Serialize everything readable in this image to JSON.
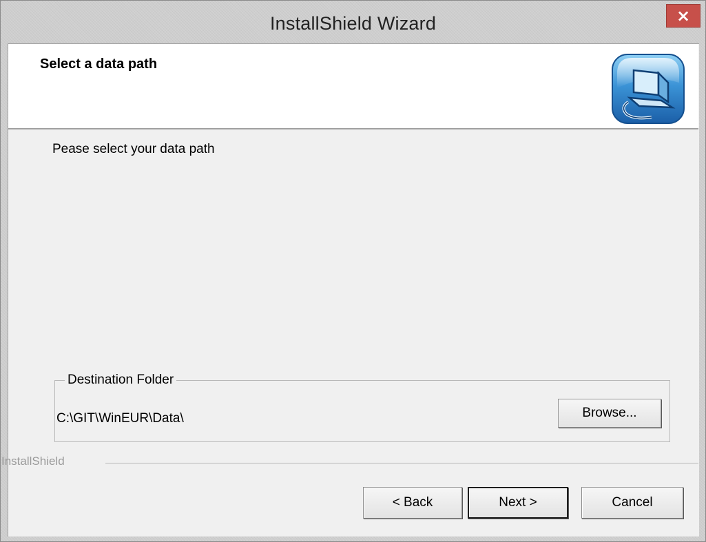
{
  "window": {
    "title": "InstallShield Wizard",
    "close_label": "×"
  },
  "header": {
    "title": "Select a data path",
    "icon": "installer-computer-icon"
  },
  "body": {
    "prompt": "Pease select your data path"
  },
  "destination": {
    "legend": "Destination Folder",
    "path": "C:\\GIT\\WinEUR\\Data\\",
    "browse_label": "Browse..."
  },
  "footer": {
    "brand": "InstallShield",
    "back_label": "< Back",
    "next_label": "Next >",
    "cancel_label": "Cancel"
  },
  "colors": {
    "close_button": "#c7504a",
    "dialog_background": "#f0f0f0",
    "header_background": "#ffffff",
    "icon_blue": "#2e7dc6"
  }
}
